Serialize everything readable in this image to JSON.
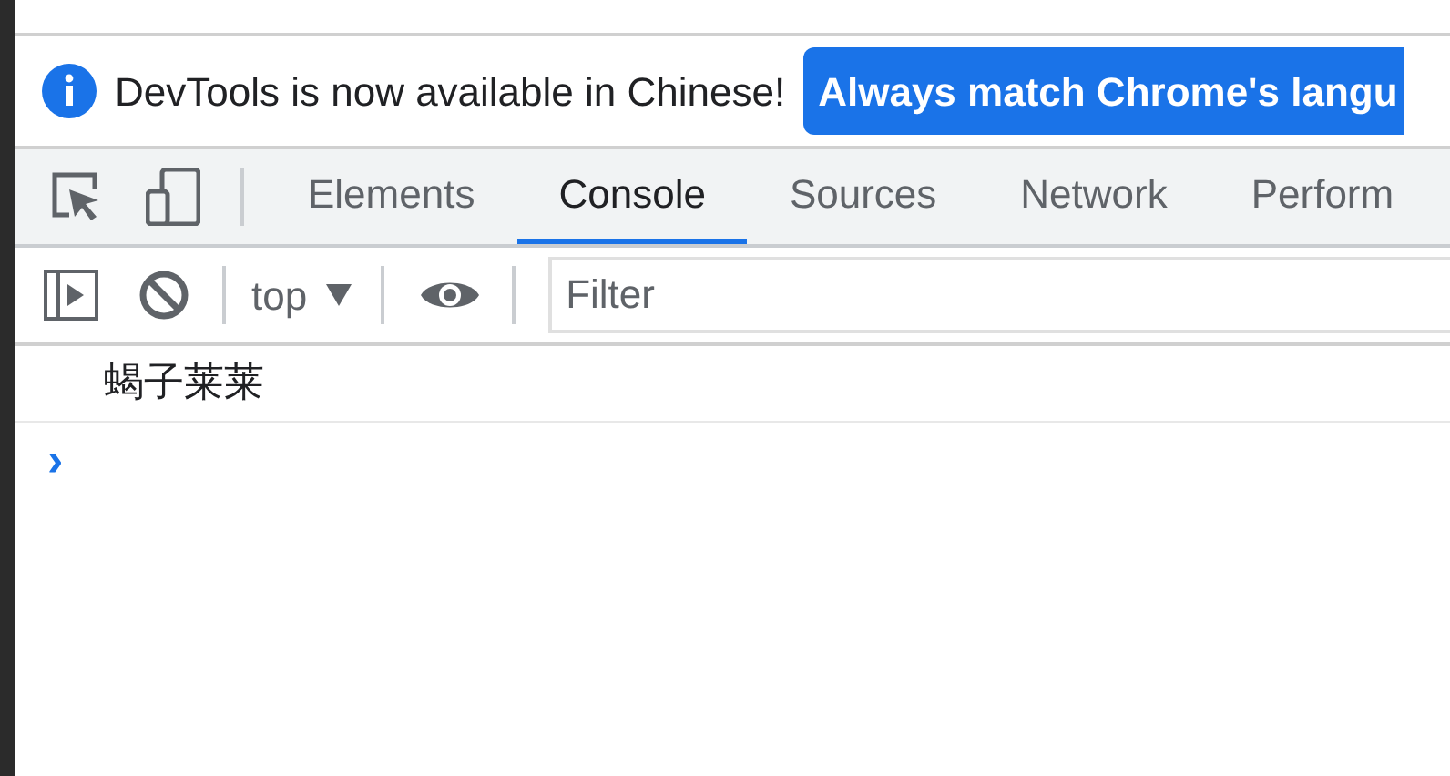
{
  "infobar": {
    "message": "DevTools is now available in Chinese!",
    "button": "Always match Chrome's langu"
  },
  "tabs": [
    {
      "label": "Elements",
      "selected": false
    },
    {
      "label": "Console",
      "selected": true
    },
    {
      "label": "Sources",
      "selected": false
    },
    {
      "label": "Network",
      "selected": false
    },
    {
      "label": "Perform",
      "selected": false
    }
  ],
  "toolbar": {
    "context": "top",
    "filter": {
      "placeholder": "Filter"
    }
  },
  "console": {
    "messages": [
      "蝎子莱莱"
    ],
    "prompt": "›"
  }
}
